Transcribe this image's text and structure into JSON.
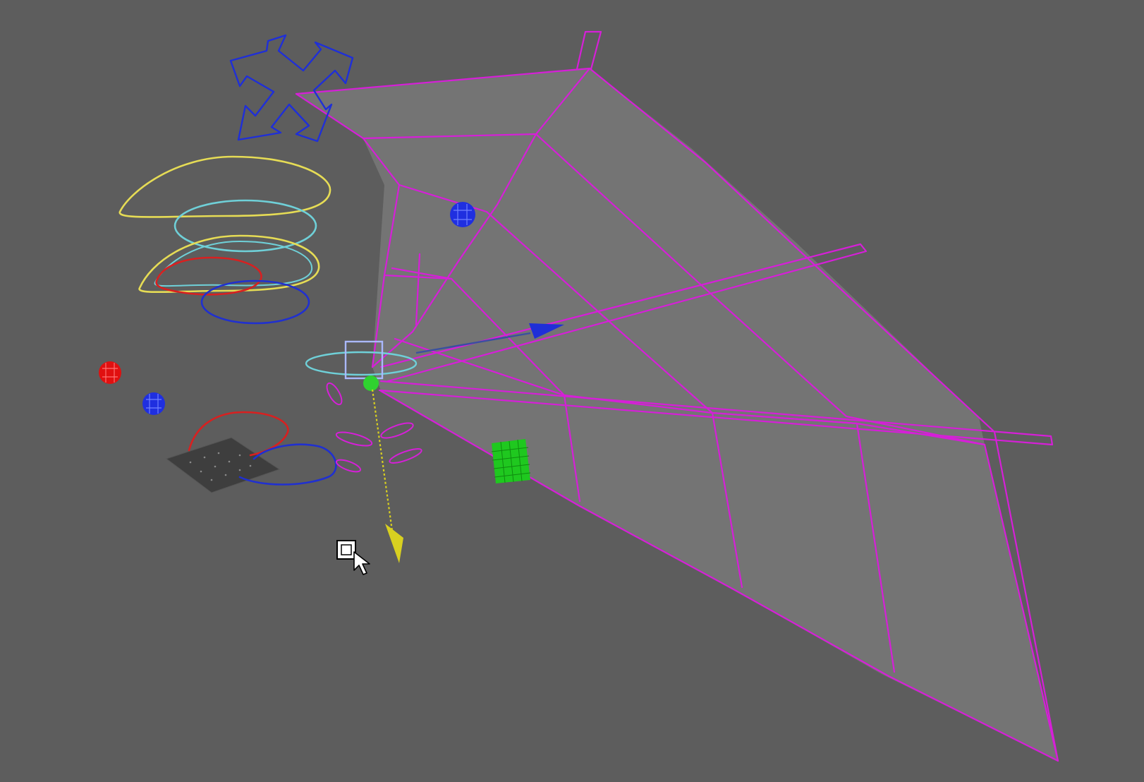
{
  "viewport": {
    "background": "#5d5d5d",
    "mesh_wire_color": "#d61fd8",
    "mesh_face_color": "#767676"
  },
  "objects": {
    "move_control": {
      "icon": "four-arrow-move-icon",
      "color": "#1f2fd8"
    },
    "ik_circles": {
      "colors": [
        "#e6dc55",
        "#6fd0d8",
        "#e6dc55",
        "#d82020",
        "#2030d0"
      ]
    },
    "locators": {
      "red": "#e01010",
      "blue": "#1f2fe0",
      "wing_blue": "#1f2fe0"
    },
    "foot_controls": {
      "colors": [
        "#d82020",
        "#2030d0"
      ]
    },
    "selected_joint": {
      "color": "#aab8ff",
      "pivot_color": "#2fd22f"
    },
    "translate_axis": {
      "color": "#d8d020"
    },
    "rotate_axis": {
      "color": "#1f2fd8"
    },
    "green_patch": {
      "color": "#1fc81f"
    }
  },
  "cursor": {
    "icon": "select-cursor-icon"
  }
}
